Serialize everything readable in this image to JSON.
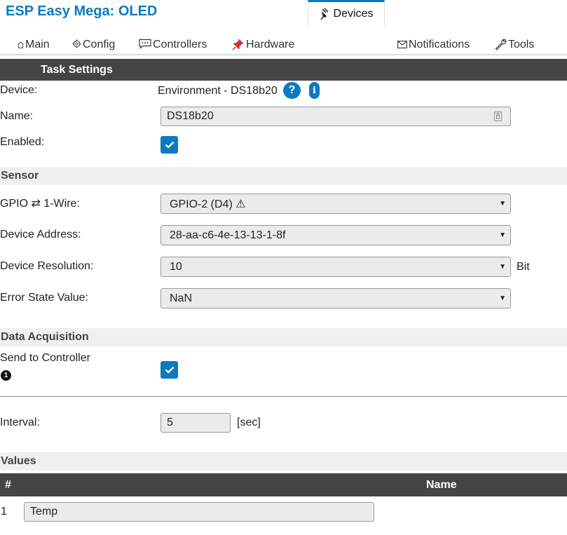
{
  "app": {
    "title": "ESP Easy Mega: OLED"
  },
  "tabs": [
    {
      "label": "Main",
      "icon": "home-icon"
    },
    {
      "label": "Config",
      "icon": "gear-icon"
    },
    {
      "label": "Controllers",
      "icon": "chat-icon"
    },
    {
      "label": "Hardware",
      "icon": "pushpin-icon"
    },
    {
      "label": "Devices",
      "icon": "plug-icon",
      "active": true
    },
    {
      "label": "Notifications",
      "icon": "envelope-icon"
    },
    {
      "label": "Tools",
      "icon": "wrench-icon"
    }
  ],
  "task_settings": {
    "header": "Task Settings",
    "device_label": "Device:",
    "device_value": "Environment - DS18b20",
    "help_glyph": "?",
    "info_glyph": "i",
    "name_label": "Name:",
    "name_value": "DS18b20",
    "enabled_label": "Enabled:",
    "enabled": true
  },
  "sensor": {
    "header": "Sensor",
    "gpio_label": "GPIO ⇄ 1-Wire:",
    "gpio_value": "GPIO-2 (D4) ⚠",
    "address_label": "Device Address:",
    "address_value": "28-aa-c6-4e-13-13-1-8f",
    "resolution_label": "Device Resolution:",
    "resolution_value": "10",
    "resolution_unit": "Bit",
    "error_label": "Error State Value:",
    "error_value": "NaN"
  },
  "data_acquisition": {
    "header": "Data Acquisition",
    "send_label": "Send to Controller",
    "controller_number": "1",
    "send_enabled": true,
    "interval_label": "Interval:",
    "interval_value": "5",
    "interval_unit": "[sec]"
  },
  "values": {
    "header": "Values",
    "columns": [
      "#",
      "Name"
    ],
    "rows": [
      {
        "index": "1",
        "name": "Temp"
      }
    ]
  },
  "colors": {
    "accent": "#0a7bc1",
    "header_dark": "#444444",
    "section_light": "#f0f0f0"
  }
}
